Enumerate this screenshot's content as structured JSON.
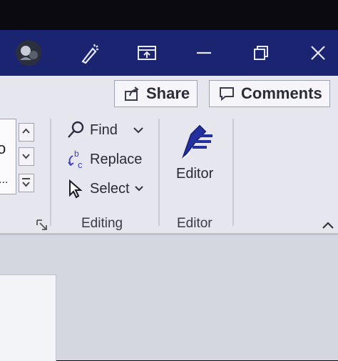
{
  "titlebar": {
    "icons": [
      "avatar",
      "designer-icon",
      "ribbon-display-icon",
      "minimize-icon",
      "restore-icon",
      "close-icon"
    ]
  },
  "header_buttons": {
    "share_label": "Share",
    "comments_label": "Comments"
  },
  "font_group": {
    "partial_text_1": "o",
    "partial_text_2": "..."
  },
  "editing": {
    "find_label": "Find",
    "replace_label": "Replace",
    "select_label": "Select",
    "group_label": "Editing"
  },
  "editor": {
    "button_label": "Editor",
    "group_label": "Editor"
  },
  "colors": {
    "titlebar": "#1b2470",
    "ribbon": "#e6e7ee",
    "accent": "#1e2a9c"
  }
}
